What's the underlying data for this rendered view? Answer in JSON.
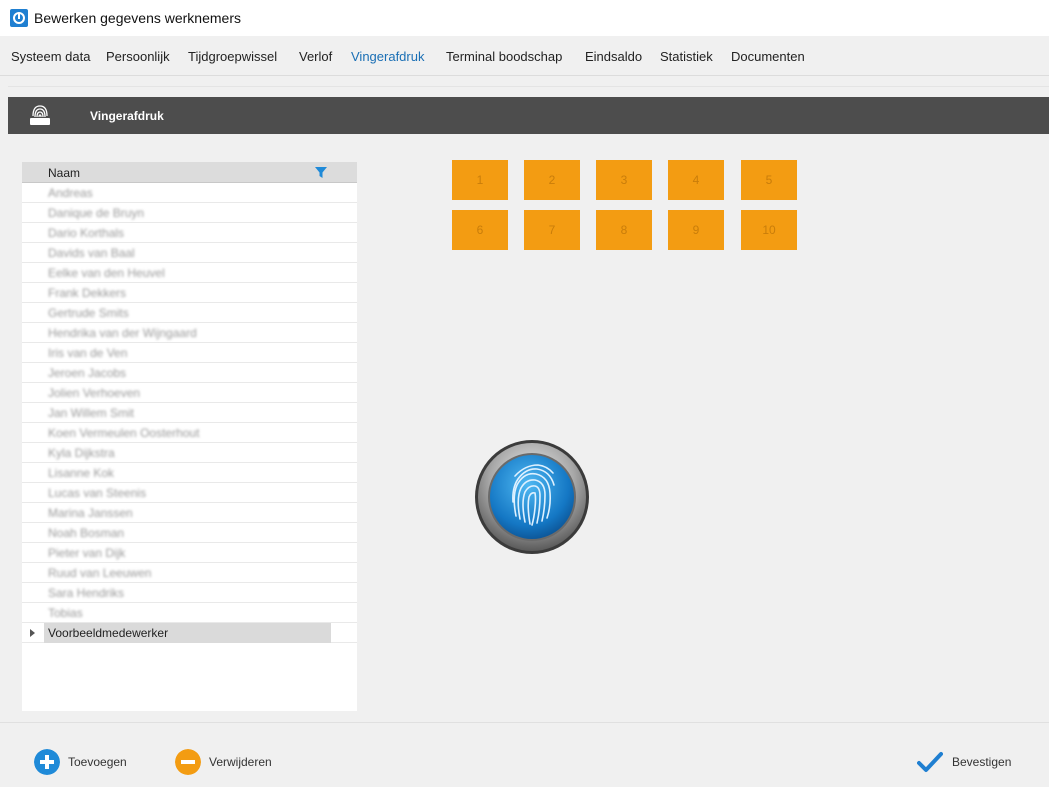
{
  "window": {
    "title": "Bewerken gegevens werknemers"
  },
  "tabs": [
    {
      "label": "Systeem data",
      "active": false
    },
    {
      "label": "Persoonlijk",
      "active": false
    },
    {
      "label": "Tijdgroepwissel",
      "active": false
    },
    {
      "label": "Verlof",
      "active": false
    },
    {
      "label": "Vingerafdruk",
      "active": true
    },
    {
      "label": "Terminal boodschap",
      "active": false
    },
    {
      "label": "Eindsaldo",
      "active": false
    },
    {
      "label": "Statistiek",
      "active": false
    },
    {
      "label": "Documenten",
      "active": false
    }
  ],
  "section": {
    "title": "Vingerafdruk",
    "icon": "fingerprint-scanner-icon"
  },
  "list": {
    "header": "Naam",
    "filter_icon": "filter-icon",
    "rows": [
      {
        "name": "Andreas",
        "blurred": true
      },
      {
        "name": "Danique de Bruyn",
        "blurred": true
      },
      {
        "name": "Dario Korthals",
        "blurred": true
      },
      {
        "name": "Davids van Baal",
        "blurred": true
      },
      {
        "name": "Eelke van den Heuvel",
        "blurred": true
      },
      {
        "name": "Frank Dekkers",
        "blurred": true
      },
      {
        "name": "Gertrude Smits",
        "blurred": true
      },
      {
        "name": "Hendrika van der Wijngaard",
        "blurred": true
      },
      {
        "name": "Iris van de Ven",
        "blurred": true
      },
      {
        "name": "Jeroen Jacobs",
        "blurred": true
      },
      {
        "name": "Jolien Verhoeven",
        "blurred": true
      },
      {
        "name": "Jan Willem Smit",
        "blurred": true
      },
      {
        "name": "Koen Vermeulen Oosterhout",
        "blurred": true
      },
      {
        "name": "Kyla Dijkstra",
        "blurred": true
      },
      {
        "name": "Lisanne Kok",
        "blurred": true
      },
      {
        "name": "Lucas van Steenis",
        "blurred": true
      },
      {
        "name": "Marina Janssen",
        "blurred": true
      },
      {
        "name": "Noah Bosman",
        "blurred": true
      },
      {
        "name": "Pieter van Dijk",
        "blurred": true
      },
      {
        "name": "Ruud van Leeuwen",
        "blurred": true
      },
      {
        "name": "Sara Hendriks",
        "blurred": true
      },
      {
        "name": "Tobias",
        "blurred": true
      },
      {
        "name": "Voorbeeldmedewerker",
        "blurred": false,
        "selected": true
      }
    ]
  },
  "fingers": [
    "1",
    "2",
    "3",
    "4",
    "5",
    "6",
    "7",
    "8",
    "9",
    "10"
  ],
  "scanner": {
    "icon": "fingerprint-icon"
  },
  "actions": {
    "add": {
      "label": "Toevoegen",
      "icon": "plus-circle-icon",
      "color": "#1f8ad8"
    },
    "remove": {
      "label": "Verwijderen",
      "icon": "minus-circle-icon",
      "color": "#f39c12"
    },
    "confirm": {
      "label": "Bevestigen",
      "icon": "checkmark-icon",
      "color": "#1f7fd1"
    }
  },
  "colors": {
    "accent": "#1a6fb5",
    "finger_button": "#f39c12",
    "header_bar": "#4d4d4d"
  }
}
